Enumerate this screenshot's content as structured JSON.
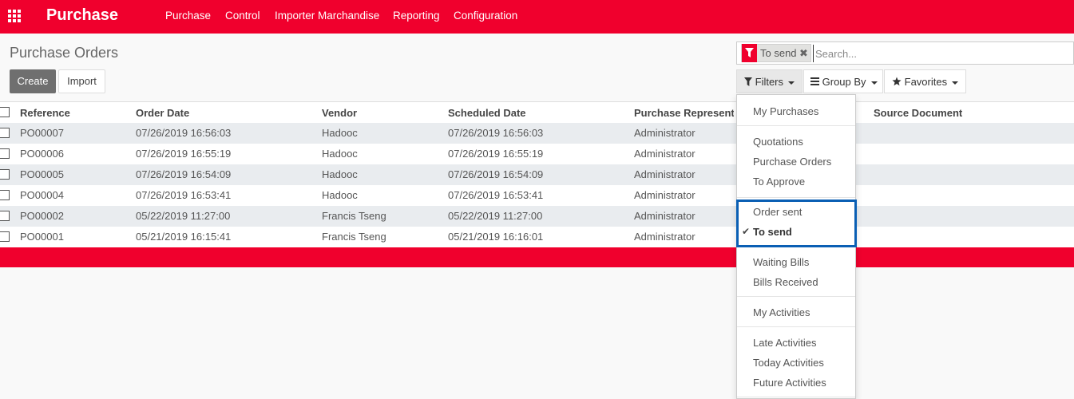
{
  "navbar": {
    "brand": "Purchase",
    "menu": [
      "Purchase",
      "Control",
      "Importer Marchandise",
      "Reporting",
      "Configuration"
    ]
  },
  "control_panel": {
    "title": "Purchase Orders",
    "create_label": "Create",
    "import_label": "Import"
  },
  "search": {
    "facet_label": "To send",
    "remove_glyph": "✖",
    "placeholder": "Search...",
    "filters_label": "Filters",
    "groupby_label": "Group By",
    "favorites_label": "Favorites"
  },
  "table": {
    "columns": [
      "Reference",
      "Order Date",
      "Vendor",
      "Scheduled Date",
      "Purchase Representative",
      "Source Document"
    ],
    "rows": [
      [
        "PO00007",
        "07/26/2019 16:56:03",
        "Hadooc",
        "07/26/2019 16:56:03",
        "Administrator",
        ""
      ],
      [
        "PO00006",
        "07/26/2019 16:55:19",
        "Hadooc",
        "07/26/2019 16:55:19",
        "Administrator",
        ""
      ],
      [
        "PO00005",
        "07/26/2019 16:54:09",
        "Hadooc",
        "07/26/2019 16:54:09",
        "Administrator",
        ""
      ],
      [
        "PO00004",
        "07/26/2019 16:53:41",
        "Hadooc",
        "07/26/2019 16:53:41",
        "Administrator",
        ""
      ],
      [
        "PO00002",
        "05/22/2019 11:27:00",
        "Francis Tseng",
        "05/22/2019 11:27:00",
        "Administrator",
        ""
      ],
      [
        "PO00001",
        "05/21/2019 16:15:41",
        "Francis Tseng",
        "05/21/2019 16:16:01",
        "Administrator",
        ""
      ]
    ]
  },
  "filters_menu": {
    "check_glyph": "✔",
    "groups": [
      [
        "My Purchases"
      ],
      [
        "Quotations",
        "Purchase Orders",
        "To Approve"
      ],
      [
        "Order sent",
        "To send"
      ],
      [
        "Waiting Bills",
        "Bills Received"
      ],
      [
        "My Activities"
      ],
      [
        "Late Activities",
        "Today Activities",
        "Future Activities"
      ]
    ],
    "active": "To send"
  },
  "colors": {
    "brand": "#f0002d",
    "highlight": "#0a5fb4"
  }
}
